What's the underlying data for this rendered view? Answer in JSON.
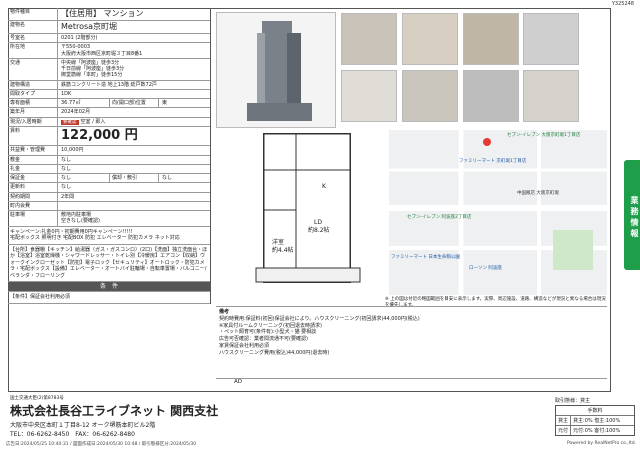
{
  "doc_id": "Y325248",
  "spec": {
    "rows": [
      {
        "k": "物件種目",
        "v": "【住居用】 マンション",
        "cls": "ptype"
      },
      {
        "k": "建物名",
        "v": "Metrosa京町堀",
        "cls": "bname"
      },
      {
        "k": "号室名",
        "v": "0201 (2階部分)"
      },
      {
        "k": "所在地",
        "v": "〒550-0003\n大阪府大阪市西区京町堀３丁目8番1"
      },
      {
        "k": "交通",
        "v": "中央線「阿波座」徒歩3分\n千日前線「阿波座」徒歩3分\n御堂筋線「本町」徒歩15分"
      },
      {
        "k": "建物構造",
        "v": "鉄筋コンクリート造 地上13階 総戸数72戸"
      }
    ],
    "layout_row": {
      "k": "間取タイプ",
      "v": "1DK"
    },
    "area_row": {
      "k": "専有面積",
      "v": "36.77㎡",
      "dir_k": "向(開口部)位置",
      "dir_v": "東"
    },
    "built_row": {
      "k": "築年月",
      "v": "2024年02月"
    },
    "status_row": {
      "k": "現況/入居時期",
      "tag": "要確認",
      "v": "空室 / 即入"
    },
    "rent_row": {
      "k": "賃料",
      "v": "122,000 円"
    },
    "fee_rows": [
      {
        "k": "共益費・管理費",
        "v": "10,000円"
      },
      {
        "k": "敷金",
        "v": "なし"
      },
      {
        "k": "礼金",
        "v": "なし"
      }
    ],
    "deposit_row": {
      "k": "保証金",
      "v": "なし",
      "k2": "償却・敷引",
      "v2": "なし"
    },
    "tail_rows": [
      {
        "k": "更新料",
        "v": "なし"
      },
      {
        "k": "契約期間",
        "v": "2年間"
      },
      {
        "k": "町内会費",
        "v": ""
      },
      {
        "k": "駐車場",
        "v": "敷地内駐車場\n空きなし(要確認)"
      }
    ],
    "campaign": "キャンペーン:礼金0円・初期費用0円キャンペーン!!!!!\n宅配ボックス 照明付き 宅配BOX 防犯 エレベーター 防犯カメラ ネット対応",
    "facilities": "【台所】食器棚【キッチン】給湯器（ガス・ガスコンロ）(2口)【洗面】独立洗面台・ほか【浴室】浴室乾燥機・シャワードレッサー・トイレ別【冷暖房】エアコン【収納】ウォークインクローゼット【防犯】電子ロック【セキュリティ】オートロック・防犯カメラ・宅配ボックス【設備】エレベーター・オートバイ駐輪場・自転車置場・バルコニー/ベランダ・フローリング",
    "conditions_head": "条　件",
    "conditions": "【条件】保証会社利用必須"
  },
  "map_note": "※ 上の図は付近の略図範囲を目安に表示します。実際、周辺施設、道路、構造などが現況と異なる場合は現況を優先します。",
  "map_labels": [
    "セブン-イレブン 大阪京町堀1丁目店",
    "ファミリーマート 京町堀1丁目店",
    "中国飯店 大阪京町堀",
    "セブン-イレブン 阿波座2丁目店",
    "ファミリーマート 日本生命靱公園",
    "ローソン 阿波座"
  ],
  "remarks": {
    "label": "備考",
    "text": "契約時費用:保証料(初回)保証会社により。ハウスクリーニング(初回請求)44,000円(税込)\n※家具付ルームクリーニング(初回退去時請求)\n・ペット飼育可(条件有):小型犬・猫 要相談\n広告可否確認：業者間流通不可(要確認)\n家賃保証会社利用必須\nハウスクリーニング費用(税込)44,000円(退去時)"
  },
  "ad_line": "AD",
  "company": {
    "trade_note": "国土交通大臣(2)第8783号",
    "name": "株式会社長谷工ライブネット 関西支社",
    "address": "大阪市中央区本町１丁目8-12 オーク堺筋本町ビル2階",
    "tel": "TEL：06-6262-8450　FAX：06-6262-8480"
  },
  "fee_box": {
    "title": "取引態様：貸主",
    "head": "手数料",
    "row1_k": "貸主",
    "row1_v": "貸主:0% 借主:100%",
    "row2_k": "元付",
    "row2_v": "元付:0% 客付:100%"
  },
  "footer_left": "広告日:2024/05/25 10:40:31 / 図面作成日:2024/05/30 10:48 / 取引態様区分:2024/05/30",
  "footer_right": "Powered by RealNetPro co.,ltd.",
  "side_tab": "業務情報"
}
